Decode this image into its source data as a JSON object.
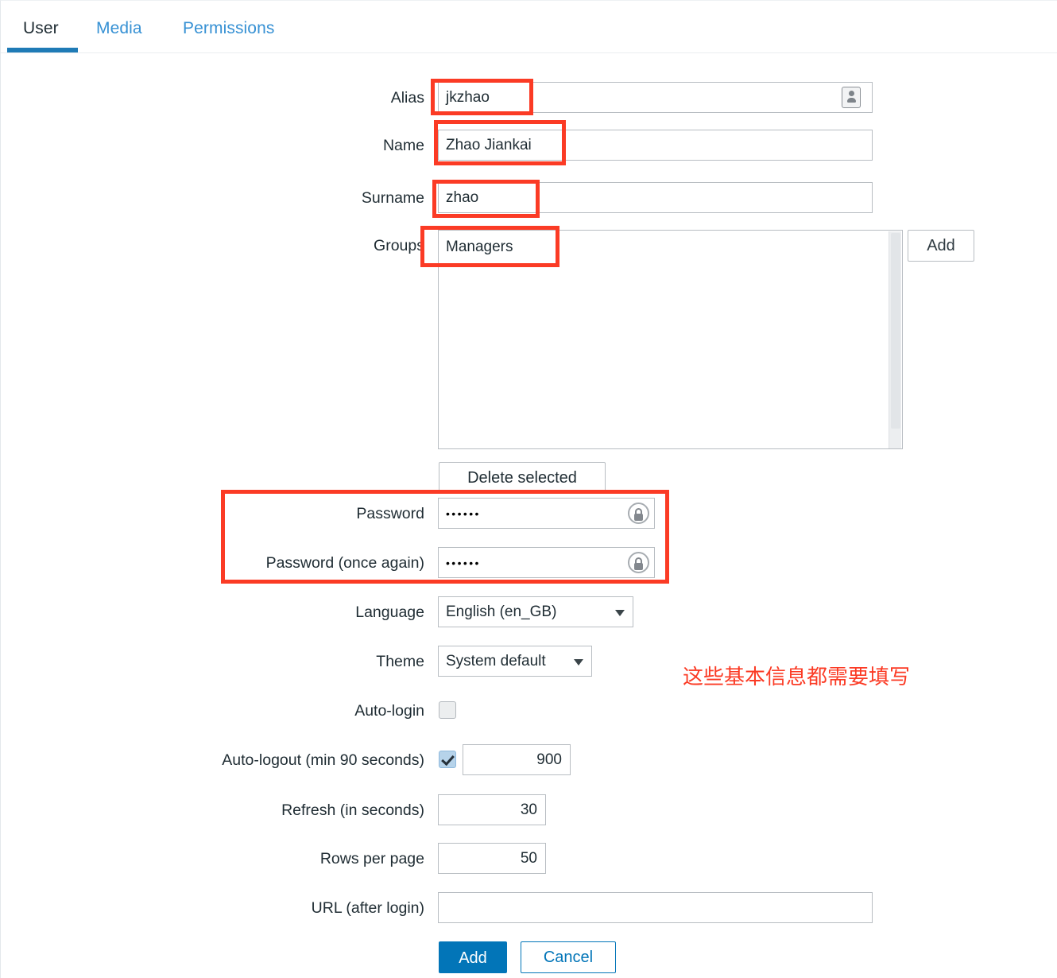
{
  "tabs": [
    {
      "label": "User",
      "active": true
    },
    {
      "label": "Media",
      "active": false
    },
    {
      "label": "Permissions",
      "active": false
    }
  ],
  "form": {
    "alias": {
      "label": "Alias",
      "value": "jkzhao",
      "icon": "contact-card-icon"
    },
    "name": {
      "label": "Name",
      "value": "Zhao Jiankai"
    },
    "surname": {
      "label": "Surname",
      "value": "zhao"
    },
    "groups": {
      "label": "Groups",
      "items": [
        "Managers"
      ],
      "add_button": "Add",
      "delete_button": "Delete selected"
    },
    "password": {
      "label": "Password",
      "value": "••••••",
      "icon": "key-icon"
    },
    "password_again": {
      "label": "Password (once again)",
      "value": "••••••",
      "icon": "key-icon"
    },
    "language": {
      "label": "Language",
      "selected": "English (en_GB)",
      "options": [
        "English (en_GB)"
      ]
    },
    "theme": {
      "label": "Theme",
      "selected": "System default",
      "options": [
        "System default"
      ]
    },
    "auto_login": {
      "label": "Auto-login",
      "checked": false
    },
    "auto_logout": {
      "label": "Auto-logout (min 90 seconds)",
      "checked": true,
      "value": "900"
    },
    "refresh": {
      "label": "Refresh (in seconds)",
      "value": "30"
    },
    "rows_per_page": {
      "label": "Rows per page",
      "value": "50"
    },
    "url_after_login": {
      "label": "URL (after login)",
      "value": "",
      "placeholder": ""
    }
  },
  "actions": {
    "submit": "Add",
    "cancel": "Cancel"
  },
  "annotation": {
    "note": "这些基本信息都需要填写",
    "color": "#fb3b25"
  },
  "colors": {
    "accent": "#0275b8",
    "tab_active_underline": "#1f7bb6",
    "tab_link": "#3791d4",
    "annotation_red": "#fb3b25",
    "field_border": "#b8bdc2",
    "text": "#1f2c33"
  }
}
